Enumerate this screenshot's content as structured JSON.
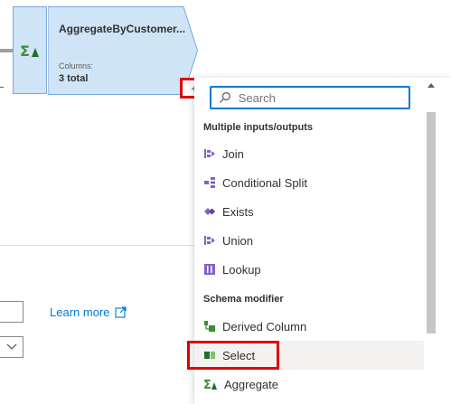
{
  "node": {
    "title": "AggregateByCustomer...",
    "columns_label": "Columns:",
    "columns_value": "3 total",
    "plus_label": "+"
  },
  "menu": {
    "search_placeholder": "Search",
    "sections": [
      {
        "header": "Multiple inputs/outputs",
        "items": [
          {
            "label": "Join",
            "icon": "join-icon"
          },
          {
            "label": "Conditional Split",
            "icon": "conditional-split-icon"
          },
          {
            "label": "Exists",
            "icon": "exists-icon"
          },
          {
            "label": "Union",
            "icon": "union-icon"
          },
          {
            "label": "Lookup",
            "icon": "lookup-icon"
          }
        ]
      },
      {
        "header": "Schema modifier",
        "items": [
          {
            "label": "Derived Column",
            "icon": "derived-column-icon"
          },
          {
            "label": "Select",
            "icon": "select-icon",
            "highlighted": true
          },
          {
            "label": "Aggregate",
            "icon": "aggregate-icon"
          }
        ]
      }
    ]
  },
  "pane": {
    "learn_more": "Learn more"
  },
  "colors": {
    "accent": "#0078d4",
    "highlight": "#e00000",
    "node_fill": "#cfe4f6"
  }
}
